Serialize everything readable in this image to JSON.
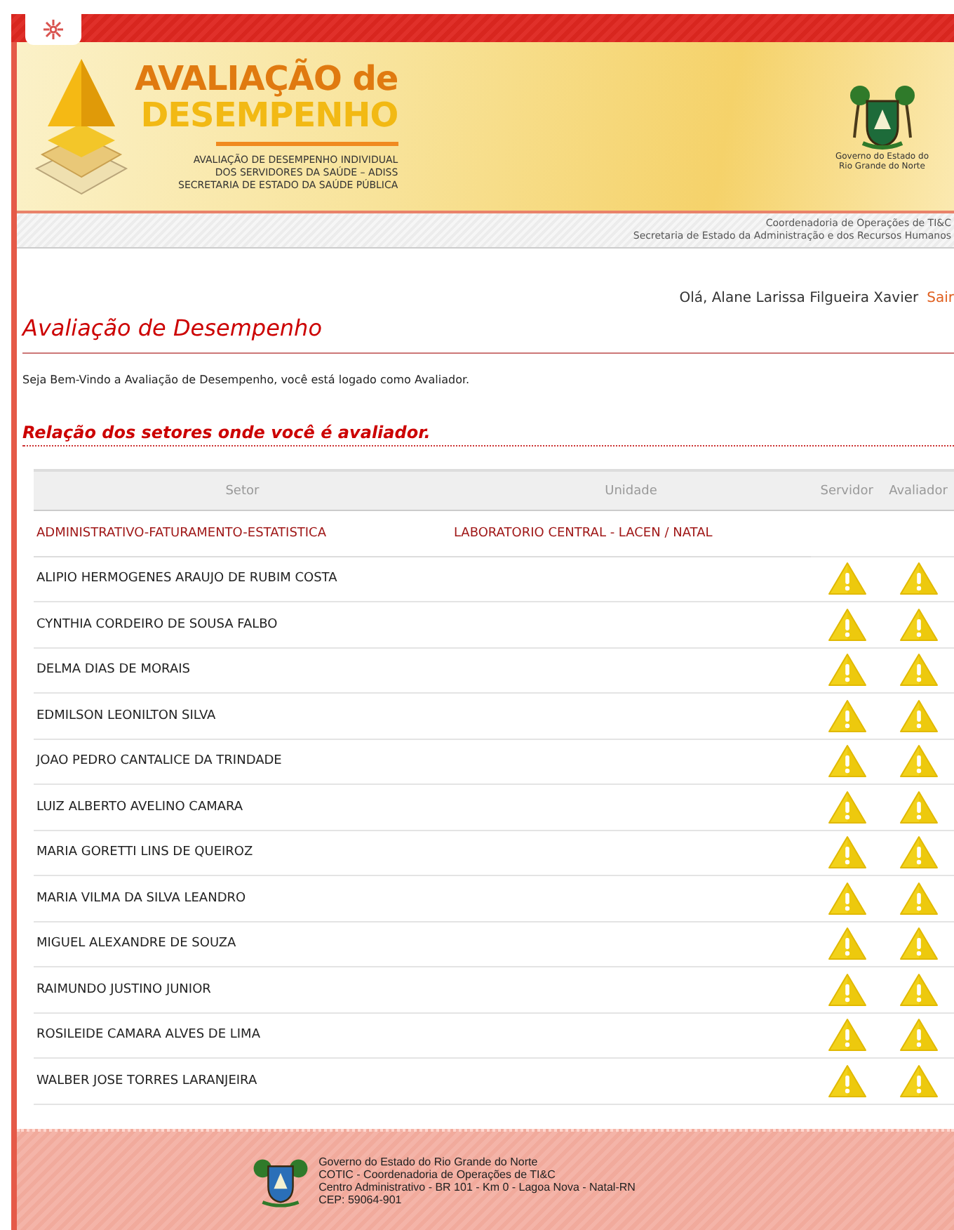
{
  "banner": {
    "title_line_1": "AVALIAÇÃO de",
    "title_line_2": "DESEMPENHO",
    "subtitle_lines": [
      "AVALIAÇÃO DE DESEMPENHO INDIVIDUAL",
      "DOS SERVIDORES DA SAÚDE – ADISS",
      "SECRETARIA DE ESTADO DA SAÚDE PÚBLICA"
    ],
    "emblem_caption": [
      "Governo do Estado do",
      "Rio Grande do Norte"
    ]
  },
  "strip": [
    "Coordenadoria de Operações de TI&C",
    "Secretaria de Estado da Administração e dos Recursos Humanos"
  ],
  "user": {
    "greeting": "Olá, Alane Larissa Filgueira Xavier",
    "logout": "Sair"
  },
  "page_title": "Avaliação de Desempenho",
  "welcome": "Seja Bem-Vindo a Avaliação de Desempenho, você está logado como Avaliador.",
  "section_title": "Relação dos setores onde você é avaliador.",
  "table": {
    "columns": [
      "Setor",
      "Unidade",
      "Servidor",
      "Avaliador"
    ],
    "rows": [
      {
        "kind": "group",
        "setor": "ADMINISTRATIVO-FATURAMENTO-ESTATISTICA",
        "unidade": "LABORATORIO CENTRAL - LACEN / NATAL"
      },
      {
        "kind": "person",
        "name": "ALIPIO HERMOGENES ARAUJO DE RUBIM COSTA"
      },
      {
        "kind": "person",
        "name": "CYNTHIA CORDEIRO DE SOUSA FALBO"
      },
      {
        "kind": "person",
        "name": "DELMA DIAS DE MORAIS"
      },
      {
        "kind": "person",
        "name": "EDMILSON LEONILTON SILVA"
      },
      {
        "kind": "person",
        "name": "JOAO PEDRO CANTALICE DA TRINDADE"
      },
      {
        "kind": "person",
        "name": "LUIZ ALBERTO AVELINO CAMARA"
      },
      {
        "kind": "person",
        "name": "MARIA GORETTI LINS DE QUEIROZ"
      },
      {
        "kind": "person",
        "name": "MARIA VILMA DA SILVA LEANDRO"
      },
      {
        "kind": "person",
        "name": "MIGUEL ALEXANDRE DE SOUZA"
      },
      {
        "kind": "person",
        "name": "RAIMUNDO JUSTINO JUNIOR"
      },
      {
        "kind": "person",
        "name": "ROSILEIDE CAMARA ALVES DE LIMA"
      },
      {
        "kind": "person",
        "name": "WALBER JOSE TORRES LARANJEIRA"
      }
    ]
  },
  "footer": [
    "Governo do Estado do Rio Grande do Norte",
    "COTIC - Coordenadoria de Operações de TI&C",
    "Centro Administrativo - BR 101 - Km 0 - Lagoa Nova - Natal-RN",
    "CEP: 59064-901"
  ]
}
